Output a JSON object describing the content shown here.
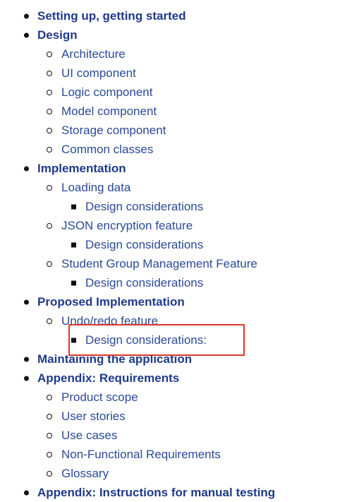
{
  "toc": {
    "items": [
      {
        "level": 1,
        "label": "Setting up, getting started"
      },
      {
        "level": 1,
        "label": "Design"
      },
      {
        "level": 2,
        "label": "Architecture"
      },
      {
        "level": 2,
        "label": "UI component"
      },
      {
        "level": 2,
        "label": "Logic component"
      },
      {
        "level": 2,
        "label": "Model component"
      },
      {
        "level": 2,
        "label": "Storage component"
      },
      {
        "level": 2,
        "label": "Common classes"
      },
      {
        "level": 1,
        "label": "Implementation"
      },
      {
        "level": 2,
        "label": "Loading data"
      },
      {
        "level": 3,
        "label": "Design considerations"
      },
      {
        "level": 2,
        "label": "JSON encryption feature"
      },
      {
        "level": 3,
        "label": "Design considerations"
      },
      {
        "level": 2,
        "label": "Student Group Management Feature"
      },
      {
        "level": 3,
        "label": "Design considerations"
      },
      {
        "level": 1,
        "label": "Proposed Implementation"
      },
      {
        "level": 2,
        "label": "Undo/redo feature"
      },
      {
        "level": 3,
        "label": "Design considerations:"
      },
      {
        "level": 1,
        "label": "Maintaining the application"
      },
      {
        "level": 1,
        "label": "Appendix: Requirements"
      },
      {
        "level": 2,
        "label": "Product scope"
      },
      {
        "level": 2,
        "label": "User stories"
      },
      {
        "level": 2,
        "label": "Use cases"
      },
      {
        "level": 2,
        "label": "Non-Functional Requirements"
      },
      {
        "level": 2,
        "label": "Glossary"
      },
      {
        "level": 1,
        "label": "Appendix: Instructions for manual testing"
      }
    ]
  },
  "colors": {
    "link": "#2a4a99",
    "link_bold": "#1f3a8a",
    "highlight_border": "#d9382c"
  }
}
